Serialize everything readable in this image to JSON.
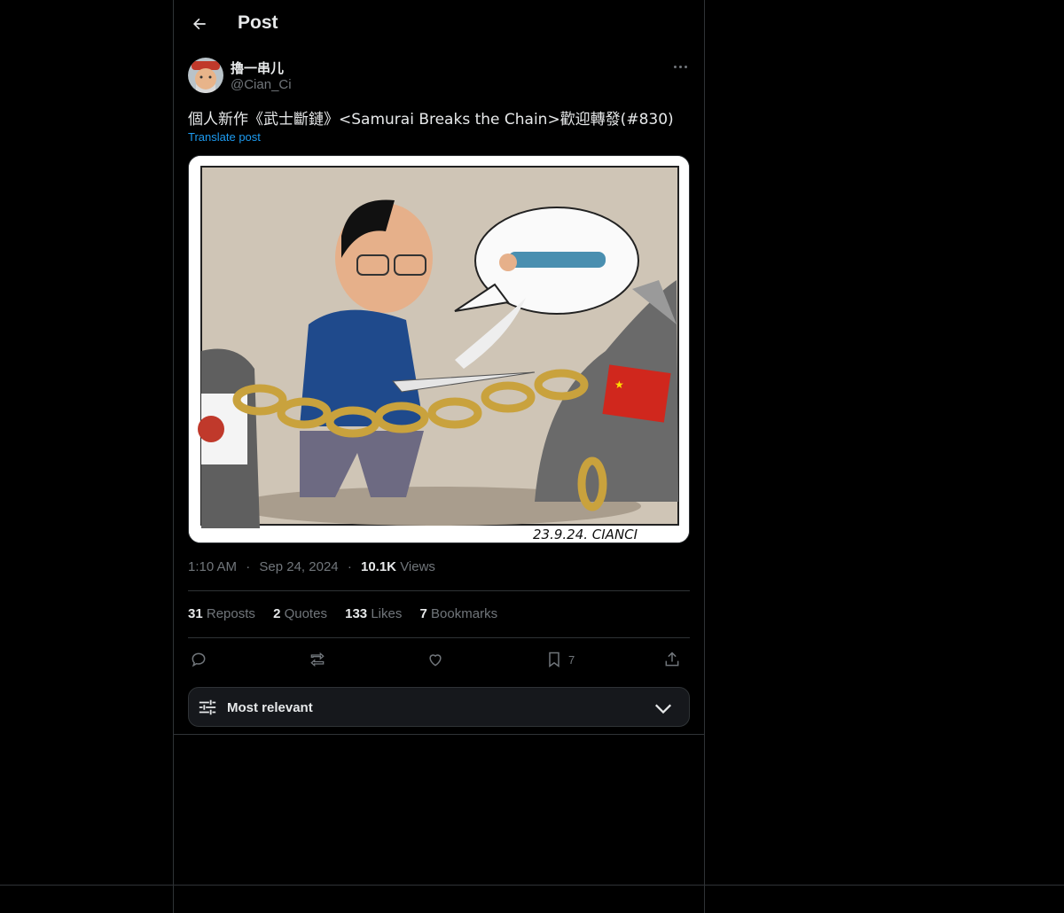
{
  "header": {
    "title": "Post"
  },
  "author": {
    "name": "擼一串儿",
    "handle": "@Cian_Ci"
  },
  "post": {
    "text": "個人新作《武士斷鏈》<Samurai Breaks the Chain>歡迎轉發(#830)",
    "translate_label": "Translate post",
    "image_signature": "23.9.24.  CIANCI"
  },
  "meta": {
    "time": "1:10 AM",
    "sep": "·",
    "date": "Sep 24, 2024",
    "views_count": "10.1K",
    "views_label": "Views"
  },
  "stats": {
    "reposts_count": "31",
    "reposts_label": "Reposts",
    "quotes_count": "2",
    "quotes_label": "Quotes",
    "likes_count": "133",
    "likes_label": "Likes",
    "bookmarks_count": "7",
    "bookmarks_label": "Bookmarks"
  },
  "actions": {
    "bookmark_count": "7"
  },
  "sort": {
    "label": "Most relevant"
  },
  "icons": [
    "back-arrow-icon",
    "more-icon",
    "reply-icon",
    "repost-icon",
    "like-icon",
    "bookmark-icon",
    "share-icon",
    "filter-icon",
    "chevron-down-icon"
  ]
}
